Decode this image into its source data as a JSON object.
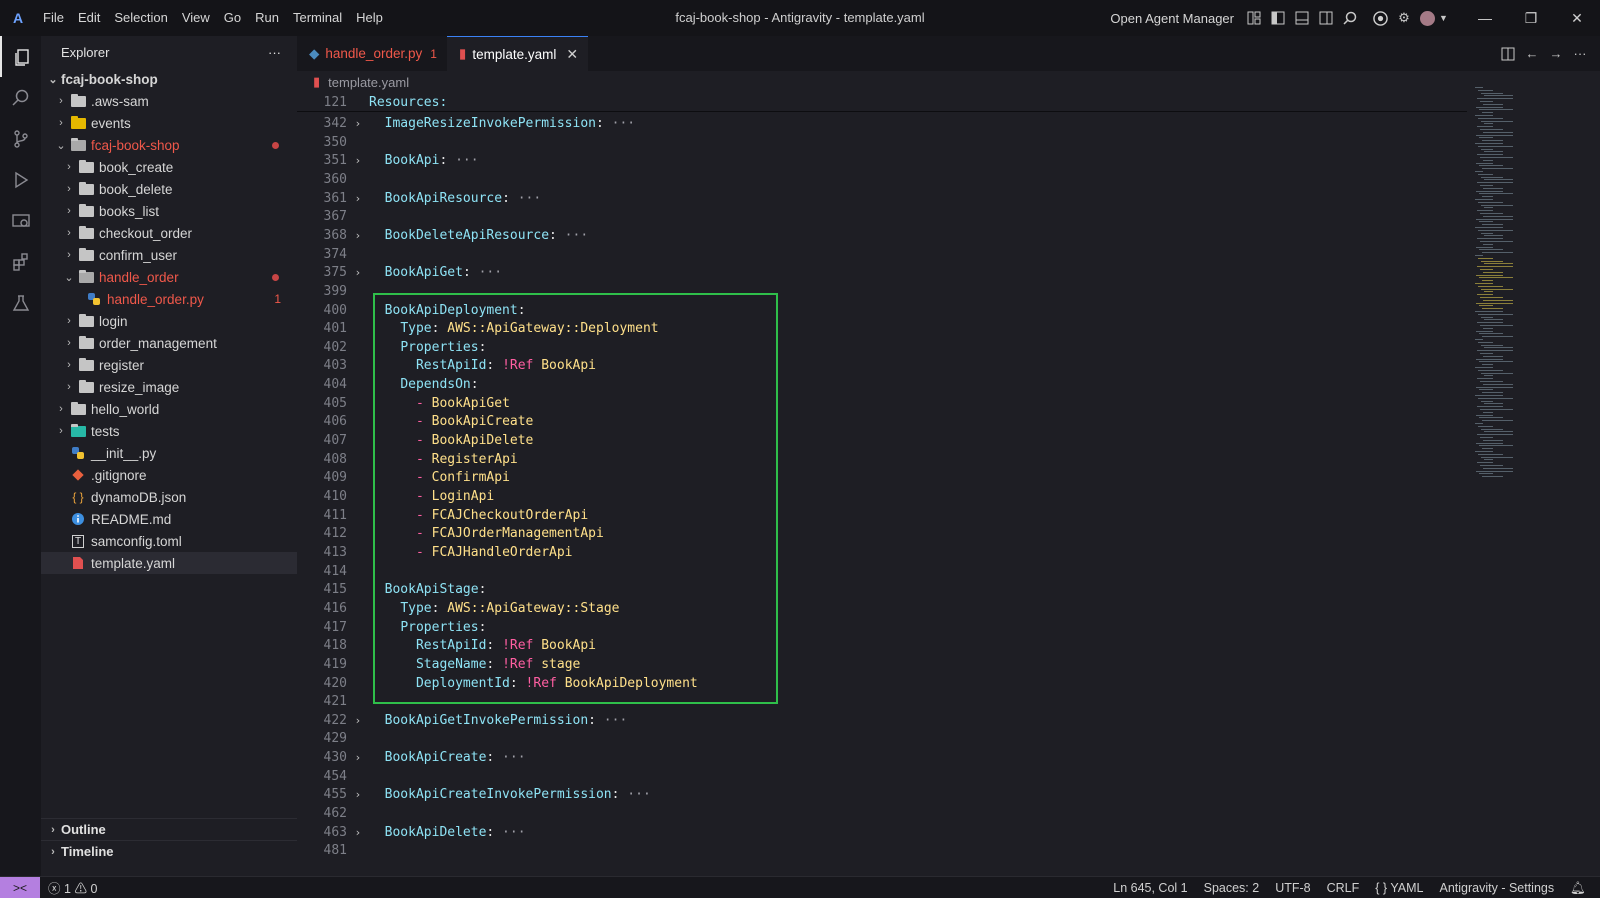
{
  "titlebar": {
    "logo": "A",
    "menu": [
      "File",
      "Edit",
      "Selection",
      "View",
      "Go",
      "Run",
      "Terminal",
      "Help"
    ],
    "window_title": "fcaj-book-shop - Antigravity - template.yaml",
    "agent_manager": "Open Agent Manager"
  },
  "sidebar": {
    "title": "Explorer",
    "more": "···",
    "root": "fcaj-book-shop",
    "items": [
      {
        "label": ".aws-sam",
        "type": "folder"
      },
      {
        "label": "events",
        "type": "folder-yellow"
      },
      {
        "label": "fcaj-book-shop",
        "type": "folder-open"
      },
      {
        "label": "book_create",
        "type": "folder"
      },
      {
        "label": "book_delete",
        "type": "folder"
      },
      {
        "label": "books_list",
        "type": "folder"
      },
      {
        "label": "checkout_order",
        "type": "folder"
      },
      {
        "label": "confirm_user",
        "type": "folder"
      },
      {
        "label": "handle_order",
        "type": "folder-open"
      },
      {
        "label": "handle_order.py",
        "type": "python"
      },
      {
        "label": "login",
        "type": "folder"
      },
      {
        "label": "order_management",
        "type": "folder"
      },
      {
        "label": "register",
        "type": "folder"
      },
      {
        "label": "resize_image",
        "type": "folder"
      },
      {
        "label": "hello_world",
        "type": "folder"
      },
      {
        "label": "tests",
        "type": "folder-test"
      },
      {
        "label": "__init__.py",
        "type": "python"
      },
      {
        "label": ".gitignore",
        "type": "git"
      },
      {
        "label": "dynamoDB.json",
        "type": "json"
      },
      {
        "label": "README.md",
        "type": "info"
      },
      {
        "label": "samconfig.toml",
        "type": "toml"
      },
      {
        "label": "template.yaml",
        "type": "yaml"
      }
    ],
    "error_count": "1",
    "outline": "Outline",
    "timeline": "Timeline"
  },
  "tabs": [
    {
      "label": "handle_order.py",
      "badge": "1"
    },
    {
      "label": "template.yaml",
      "close": "✕"
    }
  ],
  "breadcrumb": "template.yaml",
  "code": {
    "sticky": {
      "line": "121",
      "text": "Resources:"
    },
    "lines": [
      {
        "n": "342",
        "fold": true,
        "key": "ImageResizeInvokePermission"
      },
      {
        "n": "350"
      },
      {
        "n": "351",
        "fold": true,
        "key": "BookApi"
      },
      {
        "n": "360"
      },
      {
        "n": "361",
        "fold": true,
        "key": "BookApiResource"
      },
      {
        "n": "367"
      },
      {
        "n": "368",
        "fold": true,
        "key": "BookDeleteApiResource"
      },
      {
        "n": "374"
      },
      {
        "n": "375",
        "fold": true,
        "key": "BookApiGet"
      },
      {
        "n": "399"
      },
      {
        "n": "400",
        "key": "BookApiDeployment",
        "indent": 1
      },
      {
        "n": "401",
        "key": "Type",
        "value": "AWS::ApiGateway::Deployment",
        "indent": 2
      },
      {
        "n": "402",
        "key": "Properties",
        "indent": 2
      },
      {
        "n": "403",
        "key": "RestApiId",
        "tag": "!Ref",
        "value": "BookApi",
        "indent": 3
      },
      {
        "n": "404",
        "key": "DependsOn",
        "indent": 2
      },
      {
        "n": "405",
        "item": "BookApiGet",
        "indent": 3
      },
      {
        "n": "406",
        "item": "BookApiCreate",
        "indent": 3
      },
      {
        "n": "407",
        "item": "BookApiDelete",
        "indent": 3
      },
      {
        "n": "408",
        "item": "RegisterApi",
        "indent": 3
      },
      {
        "n": "409",
        "item": "ConfirmApi",
        "indent": 3
      },
      {
        "n": "410",
        "item": "LoginApi",
        "indent": 3
      },
      {
        "n": "411",
        "item": "FCAJCheckoutOrderApi",
        "indent": 3
      },
      {
        "n": "412",
        "item": "FCAJOrderManagementApi",
        "indent": 3
      },
      {
        "n": "413",
        "item": "FCAJHandleOrderApi",
        "indent": 3
      },
      {
        "n": "414"
      },
      {
        "n": "415",
        "key": "BookApiStage",
        "indent": 1
      },
      {
        "n": "416",
        "key": "Type",
        "value": "AWS::ApiGateway::Stage",
        "indent": 2
      },
      {
        "n": "417",
        "key": "Properties",
        "indent": 2
      },
      {
        "n": "418",
        "key": "RestApiId",
        "tag": "!Ref",
        "value": "BookApi",
        "indent": 3
      },
      {
        "n": "419",
        "key": "StageName",
        "tag": "!Ref",
        "value": "stage",
        "indent": 3
      },
      {
        "n": "420",
        "key": "DeploymentId",
        "tag": "!Ref",
        "value": "BookApiDeployment",
        "indent": 3
      },
      {
        "n": "421"
      },
      {
        "n": "422",
        "fold": true,
        "key": "BookApiGetInvokePermission"
      },
      {
        "n": "429"
      },
      {
        "n": "430",
        "fold": true,
        "key": "BookApiCreate"
      },
      {
        "n": "454"
      },
      {
        "n": "455",
        "fold": true,
        "key": "BookApiCreateInvokePermission"
      },
      {
        "n": "462"
      },
      {
        "n": "463",
        "fold": true,
        "key": "BookApiDelete"
      },
      {
        "n": "481"
      }
    ]
  },
  "statusbar": {
    "remote": "><",
    "errors": "1",
    "warnings": "0",
    "position": "Ln 645, Col 1",
    "spaces": "Spaces: 2",
    "encoding": "UTF-8",
    "eol": "CRLF",
    "language": "YAML",
    "settings": "Antigravity - Settings"
  }
}
